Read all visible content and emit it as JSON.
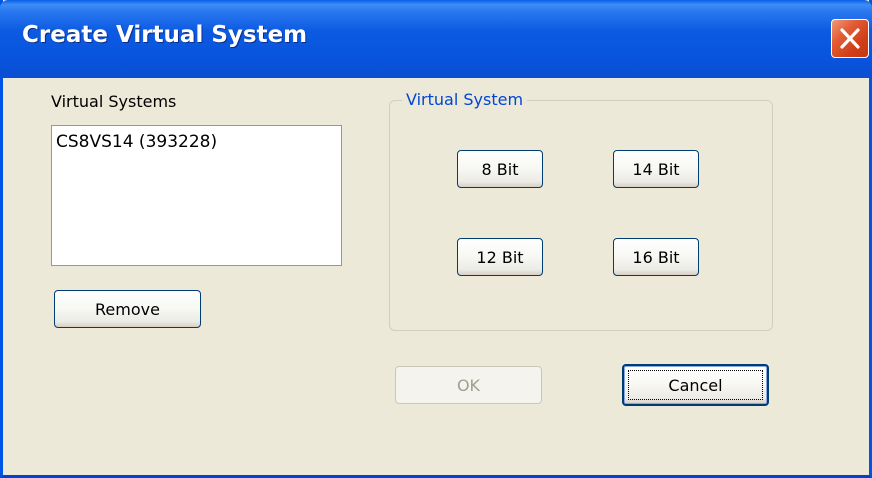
{
  "window": {
    "title": "Create Virtual System"
  },
  "virtual_systems": {
    "label": "Virtual Systems",
    "items": [
      "CS8VS14 (393228)"
    ],
    "remove_label": "Remove"
  },
  "virtual_system_group": {
    "legend": "Virtual System",
    "buttons": {
      "bit8": "8 Bit",
      "bit14": "14 Bit",
      "bit12": "12 Bit",
      "bit16": "16 Bit"
    }
  },
  "footer": {
    "ok_label": "OK",
    "ok_enabled": false,
    "cancel_label": "Cancel"
  },
  "colors": {
    "titlebar": "#0a54dd",
    "window_bg": "#ece9d8",
    "group_legend": "#0046d5",
    "close_button": "#e25b34"
  }
}
